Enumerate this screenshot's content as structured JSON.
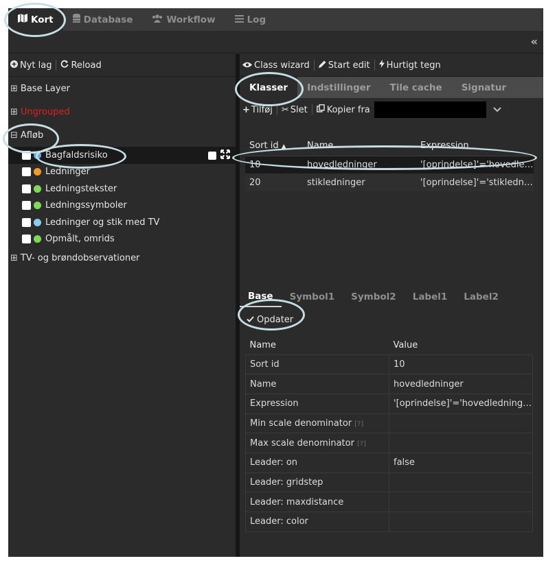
{
  "topnav": {
    "tabs": [
      {
        "label": "Kort",
        "icon": "map-icon"
      },
      {
        "label": "Database",
        "icon": "database-icon"
      },
      {
        "label": "Workflow",
        "icon": "users-icon"
      },
      {
        "label": "Log",
        "icon": "list-icon"
      }
    ],
    "collapse_label": "«"
  },
  "left": {
    "toolbar": {
      "new_layer": "Nyt lag",
      "reload": "Reload"
    },
    "groups": {
      "base": "Base Layer",
      "ungrouped": "Ungrouped",
      "aflob": "Afløb",
      "tv": "TV- og brøndobservationer"
    },
    "layers": [
      {
        "label": "Bagfaldsrisiko",
        "color": "#6aa6d8"
      },
      {
        "label": "Ledninger",
        "color": "#f39a2b"
      },
      {
        "label": "Ledningstekster",
        "color": "#7ed957"
      },
      {
        "label": "Ledningssymboler",
        "color": "#7ed957"
      },
      {
        "label": "Ledninger og stik med TV",
        "color": "#8ecbf2"
      },
      {
        "label": "Opmålt, omrids",
        "color": "#7ed957"
      }
    ]
  },
  "right": {
    "toolbar": {
      "class_wizard": "Class wizard",
      "start_edit": "Start edit",
      "quick_draw": "Hurtigt tegn"
    },
    "subtabs": [
      "Klasser",
      "Indstillinger",
      "Tile cache",
      "Signatur"
    ],
    "classbar": {
      "add": "Tilføj",
      "delete": "Slet",
      "copy_from": "Kopier fra"
    },
    "class_table": {
      "headers": [
        "Sort id",
        "Name",
        "Expression"
      ],
      "sort_indicator": "▲",
      "rows": [
        [
          "10",
          "hovedledninger",
          "'[oprindelse]'='hovedledninger'"
        ],
        [
          "20",
          "stikledninger",
          "'[oprindelse]'='stikledninger'"
        ]
      ]
    },
    "bottom_tabs": [
      "Base",
      "Symbol1",
      "Symbol2",
      "Label1",
      "Label2"
    ],
    "update_label": "Opdater",
    "prop_table": {
      "headers": [
        "Name",
        "Value"
      ],
      "help_marker": "[?]",
      "rows": [
        {
          "name": "Sort id",
          "value": "10",
          "help": false
        },
        {
          "name": "Name",
          "value": "hovedledninger",
          "help": false
        },
        {
          "name": "Expression",
          "value": "'[oprindelse]'='hovedledninger'",
          "help": false
        },
        {
          "name": "Min scale denominator",
          "value": "",
          "help": true
        },
        {
          "name": "Max scale denominator",
          "value": "",
          "help": true
        },
        {
          "name": "Leader: on",
          "value": "false",
          "help": false
        },
        {
          "name": "Leader: gridstep",
          "value": "",
          "help": false
        },
        {
          "name": "Leader: maxdistance",
          "value": "",
          "help": false
        },
        {
          "name": "Leader: color",
          "value": "",
          "help": false
        }
      ]
    }
  },
  "colors": {
    "accent_highlight": "#c7dde4",
    "ungrouped_red": "#e02020"
  }
}
